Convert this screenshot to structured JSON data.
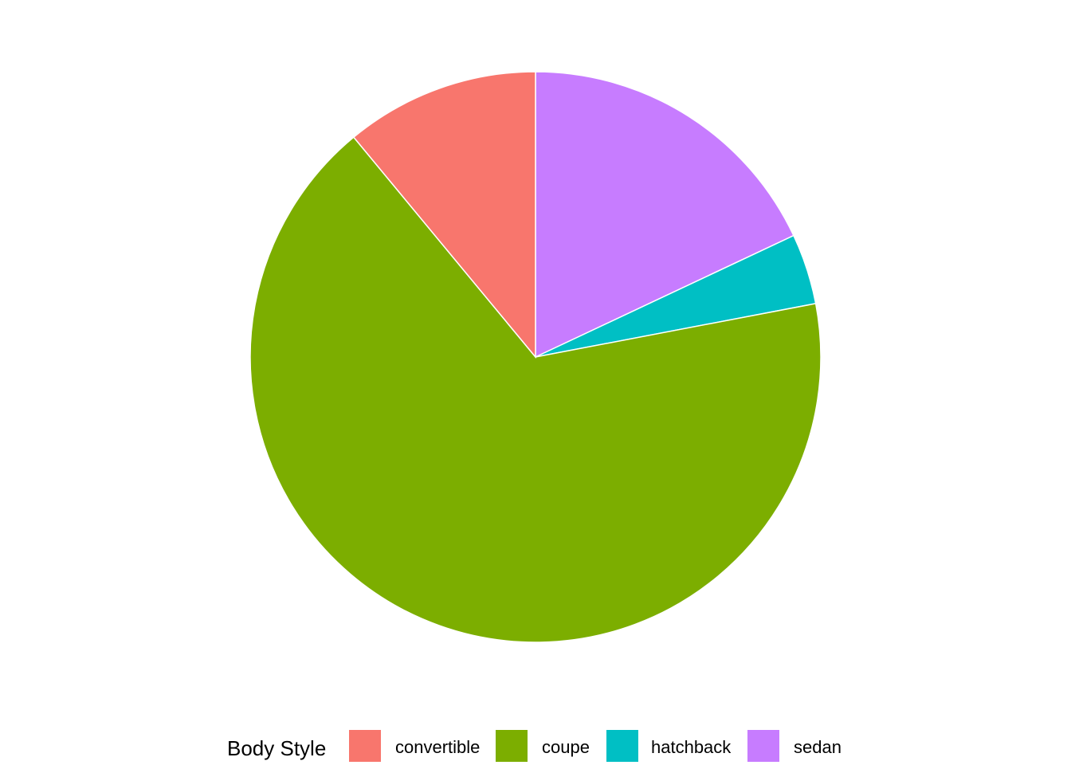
{
  "chart_data": {
    "type": "pie",
    "title": "",
    "legend": {
      "title": "Body Style",
      "placement": "bottom"
    },
    "categories": [
      "convertible",
      "coupe",
      "hatchback",
      "sedan"
    ],
    "values": [
      11,
      67,
      4,
      18
    ],
    "colors": [
      "#F8766D",
      "#7CAE00",
      "#00BFC4",
      "#C77CFF"
    ],
    "slice_order": [
      "sedan",
      "hatchback",
      "coupe",
      "convertible"
    ],
    "direction": "clockwise-from-top"
  }
}
